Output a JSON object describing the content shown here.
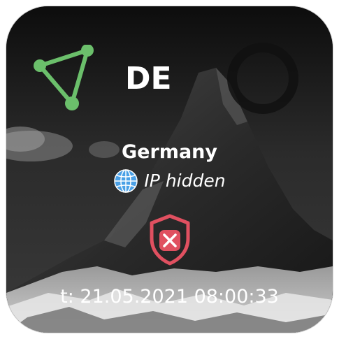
{
  "widget": {
    "country_code": "DE",
    "country_name": "Germany",
    "ip_status": "IP hidden",
    "timestamp": "t: 21.05.2021 08:00:33",
    "status": "disconnected",
    "accent_color": "#6bbf6b",
    "status_color": "#e05060"
  },
  "icons": {
    "logo": "protonvpn-triangle-logo-icon",
    "status_ring": "ring-icon",
    "ip": "globe-icon",
    "connection": "shield-x-icon"
  }
}
